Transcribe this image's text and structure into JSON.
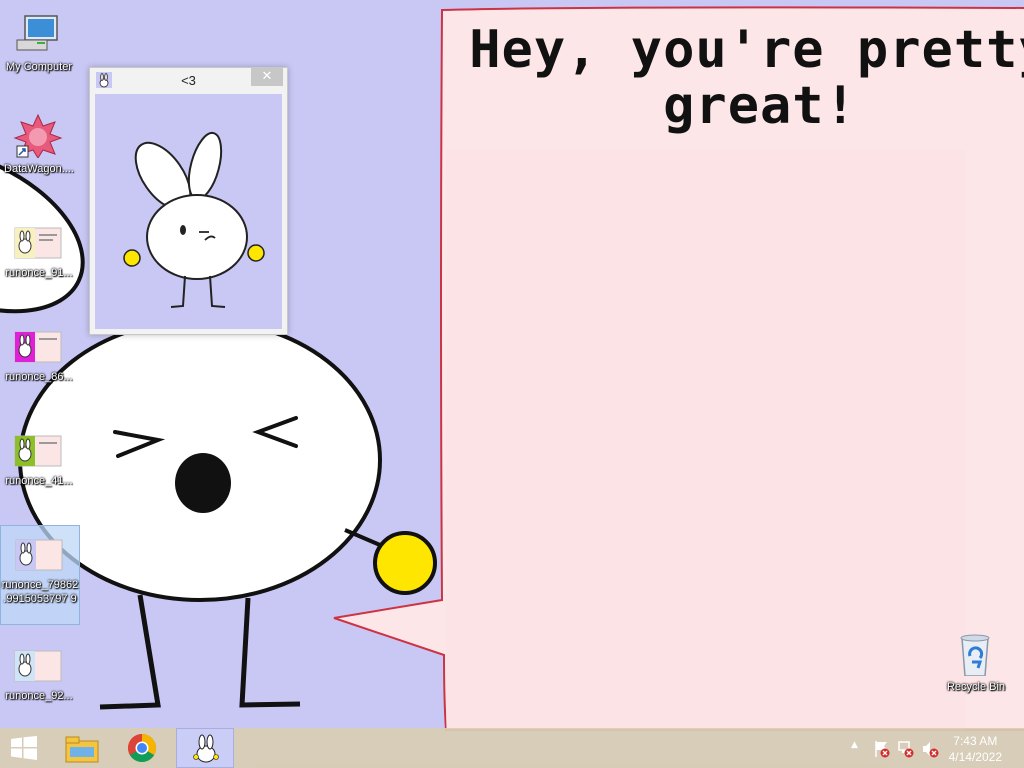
{
  "wallpaper": {
    "speech_line1": "Hey, you're pretty",
    "speech_line2": "great!"
  },
  "desktop_icons": [
    {
      "label": "My Computer",
      "icon": "computer-icon"
    },
    {
      "label": "DataWagon....",
      "icon": "datawagon-shortcut-icon"
    },
    {
      "label": "runonce_91...",
      "icon": "runonce-image-icon"
    },
    {
      "label": "runonce_86...",
      "icon": "runonce-image-icon"
    },
    {
      "label": "runonce_41...",
      "icon": "runonce-image-icon"
    },
    {
      "label": "runonce_79862.9915053797 9",
      "icon": "runonce-image-icon"
    },
    {
      "label": "runonce_92...",
      "icon": "runonce-image-icon"
    }
  ],
  "recycle_bin": {
    "label": "Recycle Bin"
  },
  "popup": {
    "title": "<3",
    "close": "✕"
  },
  "taskbar": {
    "time": "7:43 AM",
    "date": "4/14/2022",
    "tray_arrow": "▲"
  },
  "colors": {
    "wallpaper_bg": "#c9c8f5",
    "speech_bubble": "#fde6e8",
    "bubble_outline": "#cc3344",
    "rabbit_hands": "#ffe600"
  }
}
